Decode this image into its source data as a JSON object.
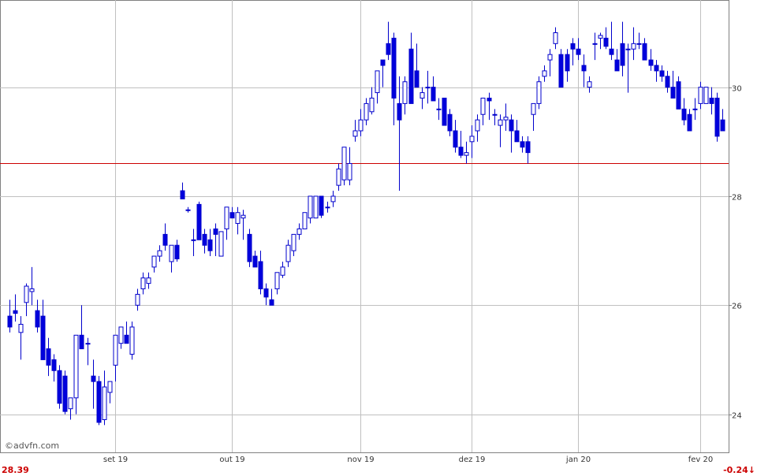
{
  "watermark": "©advfn.com",
  "footer": {
    "last_price": "28.39",
    "change": "-0.24",
    "change_arrow": "↓"
  },
  "colors": {
    "up_candle_fill": "#ffffff",
    "down_candle_fill": "#0000dd",
    "candle_outline": "#0000cc",
    "grid": "#c0c0c0",
    "reference_line": "#cc0000",
    "footer_text": "#cc0000"
  },
  "chart_data": {
    "type": "candlestick",
    "title": "",
    "xlabel": "",
    "ylabel": "",
    "ylim": [
      23.3,
      31.6
    ],
    "y_ticks": [
      24,
      26,
      28,
      30
    ],
    "x_ticks": [
      {
        "label": "set 19",
        "index": 19
      },
      {
        "label": "out 19",
        "index": 40
      },
      {
        "label": "nov 19",
        "index": 63
      },
      {
        "label": "dez 19",
        "index": 83
      },
      {
        "label": "jan 20",
        "index": 102
      },
      {
        "label": "fev 20",
        "index": 124
      }
    ],
    "reference_line": 28.6,
    "grid": true,
    "candles": [
      [
        25.8,
        26.1,
        25.5,
        25.6
      ],
      [
        25.9,
        26.2,
        25.7,
        25.85
      ],
      [
        25.5,
        25.8,
        25.0,
        25.65
      ],
      [
        26.05,
        26.4,
        25.8,
        26.35
      ],
      [
        26.25,
        26.7,
        26.0,
        26.3
      ],
      [
        25.9,
        26.1,
        25.5,
        25.6
      ],
      [
        25.8,
        26.1,
        25.1,
        25.0
      ],
      [
        25.2,
        25.4,
        24.7,
        24.9
      ],
      [
        25.0,
        25.1,
        24.6,
        24.8
      ],
      [
        24.8,
        24.9,
        24.1,
        24.2
      ],
      [
        24.7,
        24.8,
        24.0,
        24.05
      ],
      [
        24.1,
        24.3,
        23.9,
        24.3
      ],
      [
        24.3,
        25.2,
        24.0,
        25.45
      ],
      [
        25.45,
        26.0,
        25.3,
        25.2
      ],
      [
        25.3,
        25.4,
        24.9,
        25.3
      ],
      [
        24.7,
        25.0,
        24.1,
        24.6
      ],
      [
        24.6,
        24.7,
        23.8,
        23.85
      ],
      [
        23.9,
        24.8,
        23.8,
        24.5
      ],
      [
        24.4,
        24.6,
        24.2,
        24.6
      ],
      [
        24.9,
        25.4,
        24.6,
        25.45
      ],
      [
        25.3,
        25.6,
        25.2,
        25.6
      ],
      [
        25.45,
        25.7,
        25.3,
        25.3
      ],
      [
        25.1,
        25.7,
        25.0,
        25.6
      ],
      [
        26.0,
        26.3,
        25.9,
        26.2
      ],
      [
        26.3,
        26.6,
        26.2,
        26.5
      ],
      [
        26.4,
        26.6,
        26.3,
        26.5
      ],
      [
        26.7,
        26.9,
        26.6,
        26.9
      ],
      [
        26.9,
        27.1,
        26.8,
        27.0
      ],
      [
        27.3,
        27.5,
        27.0,
        27.1
      ],
      [
        26.8,
        27.1,
        26.6,
        27.1
      ],
      [
        27.1,
        27.2,
        26.8,
        26.85
      ],
      [
        28.1,
        28.25,
        28.0,
        27.95
      ],
      [
        27.75,
        27.8,
        27.7,
        27.75
      ],
      [
        27.2,
        27.4,
        26.9,
        27.2
      ],
      [
        27.85,
        27.9,
        27.2,
        27.2
      ],
      [
        27.3,
        27.4,
        26.95,
        27.1
      ],
      [
        27.2,
        27.4,
        26.9,
        27.0
      ],
      [
        27.4,
        27.5,
        26.9,
        27.3
      ],
      [
        26.9,
        27.3,
        26.9,
        27.35
      ],
      [
        27.4,
        27.8,
        27.2,
        27.8
      ],
      [
        27.7,
        27.8,
        27.6,
        27.6
      ],
      [
        27.5,
        27.8,
        27.3,
        27.7
      ],
      [
        27.6,
        27.75,
        27.2,
        27.65
      ],
      [
        27.3,
        27.4,
        26.7,
        26.8
      ],
      [
        26.9,
        27.0,
        26.8,
        26.7
      ],
      [
        26.8,
        27.0,
        26.2,
        26.3
      ],
      [
        26.3,
        26.4,
        26.0,
        26.15
      ],
      [
        26.1,
        26.3,
        26.0,
        26.0
      ],
      [
        26.3,
        26.6,
        26.2,
        26.6
      ],
      [
        26.55,
        26.8,
        26.5,
        26.7
      ],
      [
        26.8,
        27.2,
        26.7,
        27.1
      ],
      [
        27.0,
        27.3,
        26.9,
        27.3
      ],
      [
        27.3,
        27.5,
        27.2,
        27.4
      ],
      [
        27.4,
        27.7,
        27.4,
        27.7
      ],
      [
        27.6,
        28.0,
        27.5,
        28.0
      ],
      [
        27.6,
        28.0,
        27.6,
        28.0
      ],
      [
        28.0,
        28.0,
        27.6,
        27.65
      ],
      [
        27.8,
        27.9,
        27.7,
        27.8
      ],
      [
        27.9,
        28.1,
        27.8,
        28.0
      ],
      [
        28.2,
        28.6,
        28.1,
        28.5
      ],
      [
        28.3,
        28.8,
        28.2,
        28.9
      ],
      [
        28.3,
        28.9,
        28.2,
        28.6
      ],
      [
        29.1,
        29.4,
        29.0,
        29.2
      ],
      [
        29.2,
        29.6,
        29.1,
        29.4
      ],
      [
        29.4,
        29.8,
        29.3,
        29.7
      ],
      [
        29.55,
        30.0,
        29.5,
        29.8
      ],
      [
        29.9,
        30.3,
        29.7,
        30.3
      ],
      [
        30.5,
        30.5,
        30.0,
        30.4
      ],
      [
        30.8,
        31.2,
        30.5,
        30.6
      ],
      [
        30.9,
        31.0,
        29.3,
        29.8
      ],
      [
        29.7,
        30.2,
        28.1,
        29.4
      ],
      [
        29.7,
        30.2,
        29.5,
        30.1
      ],
      [
        30.7,
        31.0,
        29.8,
        29.7
      ],
      [
        30.3,
        30.8,
        30.2,
        30.0
      ],
      [
        29.8,
        30.0,
        29.6,
        29.9
      ],
      [
        30.0,
        30.3,
        29.7,
        30.0
      ],
      [
        30.0,
        30.2,
        29.8,
        29.75
      ],
      [
        29.6,
        29.8,
        29.4,
        29.6
      ],
      [
        29.8,
        29.8,
        29.5,
        29.3
      ],
      [
        29.5,
        29.6,
        29.1,
        29.2
      ],
      [
        29.2,
        29.4,
        28.8,
        28.9
      ],
      [
        28.9,
        29.2,
        28.7,
        28.75
      ],
      [
        28.75,
        29.0,
        28.6,
        28.8
      ],
      [
        29.0,
        29.3,
        28.7,
        29.1
      ],
      [
        29.2,
        29.5,
        29.0,
        29.4
      ],
      [
        29.5,
        29.8,
        29.3,
        29.8
      ],
      [
        29.8,
        29.9,
        29.4,
        29.75
      ],
      [
        29.5,
        29.6,
        29.3,
        29.5
      ],
      [
        29.3,
        29.5,
        28.9,
        29.4
      ],
      [
        29.4,
        29.7,
        29.2,
        29.45
      ],
      [
        29.4,
        29.5,
        28.8,
        29.2
      ],
      [
        29.2,
        29.4,
        29.0,
        29.0
      ],
      [
        29.0,
        29.1,
        28.8,
        28.9
      ],
      [
        29.0,
        29.1,
        28.6,
        28.8
      ],
      [
        29.5,
        29.7,
        29.2,
        29.7
      ],
      [
        29.7,
        30.2,
        29.6,
        30.1
      ],
      [
        30.2,
        30.4,
        30.1,
        30.3
      ],
      [
        30.5,
        30.7,
        30.2,
        30.6
      ],
      [
        30.8,
        31.1,
        30.7,
        31.0
      ],
      [
        30.6,
        30.7,
        30.3,
        30.0
      ],
      [
        30.6,
        30.7,
        30.1,
        30.3
      ],
      [
        30.8,
        30.9,
        30.4,
        30.7
      ],
      [
        30.7,
        30.9,
        30.5,
        30.6
      ],
      [
        30.4,
        30.6,
        30.0,
        30.3
      ],
      [
        30.0,
        30.2,
        29.9,
        30.1
      ],
      [
        30.8,
        31.0,
        30.5,
        30.8
      ],
      [
        30.9,
        31.0,
        30.7,
        30.95
      ],
      [
        30.9,
        31.1,
        30.7,
        30.75
      ],
      [
        30.7,
        31.2,
        30.5,
        30.6
      ],
      [
        30.5,
        30.7,
        30.3,
        30.3
      ],
      [
        30.8,
        31.2,
        30.2,
        30.4
      ],
      [
        30.7,
        30.8,
        29.9,
        30.7
      ],
      [
        30.7,
        31.1,
        30.5,
        30.8
      ],
      [
        30.8,
        31.0,
        30.7,
        30.8
      ],
      [
        30.8,
        30.9,
        30.5,
        30.5
      ],
      [
        30.5,
        30.7,
        30.3,
        30.4
      ],
      [
        30.4,
        30.5,
        30.1,
        30.3
      ],
      [
        30.3,
        30.4,
        30.1,
        30.2
      ],
      [
        30.2,
        30.3,
        29.9,
        30.0
      ],
      [
        30.0,
        30.3,
        29.9,
        29.8
      ],
      [
        30.1,
        30.2,
        29.6,
        29.6
      ],
      [
        29.6,
        29.8,
        29.3,
        29.4
      ],
      [
        29.5,
        29.6,
        29.3,
        29.2
      ],
      [
        29.6,
        29.8,
        29.4,
        29.6
      ],
      [
        29.7,
        30.1,
        29.6,
        30.0
      ],
      [
        29.7,
        30.0,
        29.7,
        30.0
      ],
      [
        29.8,
        30.0,
        29.5,
        29.7
      ],
      [
        29.8,
        29.9,
        29.0,
        29.1
      ],
      [
        29.4,
        29.6,
        29.2,
        29.2
      ]
    ]
  }
}
